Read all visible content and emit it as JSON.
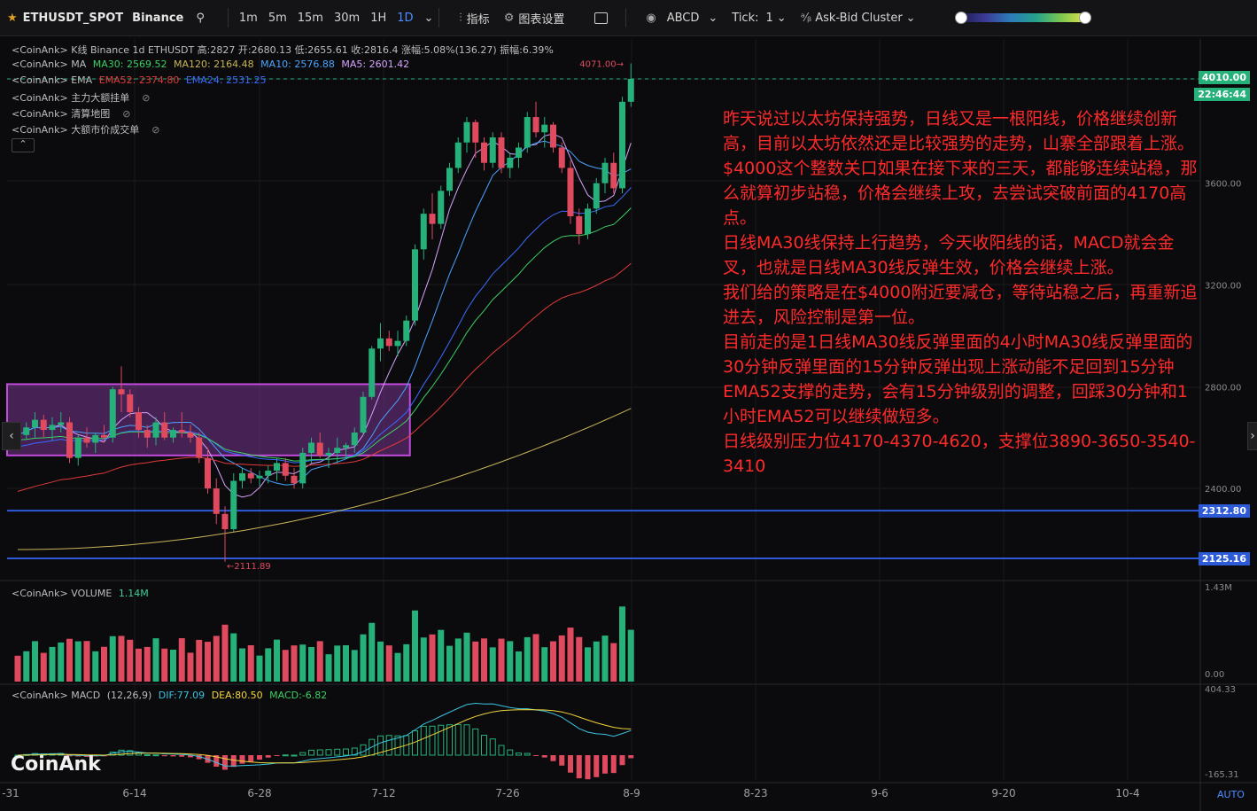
{
  "toolbar": {
    "symbol": "ETHUSDT_SPOT",
    "exchange": "Binance",
    "timeframes": [
      "1m",
      "5m",
      "15m",
      "30m",
      "1H",
      "1D"
    ],
    "active_timeframe": "1D",
    "indicators_label": "指标",
    "chart_settings_label": "图表设置",
    "abcd_label": "ABCD",
    "tick_label": "Tick:",
    "tick_value": "1",
    "cluster_label": "Ask-Bid Cluster"
  },
  "legend": {
    "kline": "<CoinAnk> K线  Binance 1d ETHUSDT 高:2827  开:2680.13  低:2655.61  收:2816.4  涨幅:5.08%(136.27)  振幅:6.39%",
    "ma_prefix": "<CoinAnk> MA",
    "ma30": "MA30: 2569.52",
    "ma120": "MA120: 2164.48",
    "ma10": "MA10: 2576.88",
    "ma5": "MA5: 2601.42",
    "ema_prefix": "<CoinAnk> EMA",
    "ema52": "EMA52: 2374.80",
    "ema24": "EMA24: 2531.25",
    "l4": "<CoinAnk> 主力大额挂单",
    "l5": "<CoinAnk> 清算地图",
    "l6": "<CoinAnk> 大额市价成交单",
    "volume_prefix": "<CoinAnk> VOLUME",
    "volume_value": "1.14M",
    "macd_prefix": "<CoinAnk> MACD",
    "macd_params": "(12,26,9)",
    "dif": "DIF:77.09",
    "dea": "DEA:80.50",
    "macd": "MACD:-6.82"
  },
  "price_axis": {
    "ticks": [
      "3600.00",
      "3200.00",
      "2800.00",
      "2400.00"
    ],
    "current_price": "4010.00",
    "countdown": "22:46:44",
    "line1": "2312.80",
    "line2": "2125.16",
    "high_marker": "4071.00",
    "low_marker": "2111.89"
  },
  "volume_axis": {
    "top": "1.43M",
    "bottom": "0.00"
  },
  "macd_axis": {
    "top": "404.33",
    "bottom": "-165.31"
  },
  "x_axis": [
    "-31",
    "6-14",
    "6-28",
    "7-12",
    "7-26",
    "8-9",
    "8-23",
    "9-6",
    "9-20",
    "10-4"
  ],
  "annotation": [
    "昨天说过以太坊保持强势，日线又是一根阳线，价格继续创新高，目前以太坊依然还是比较强势的走势，山寨全部跟着上涨。",
    "$4000这个整数关口如果在接下来的三天，都能够连续站稳，那么就算初步站稳，价格会继续上攻，去尝试突破前面的4170高点。",
    "日线MA30线保持上行趋势，今天收阳线的话，MACD就会金叉，也就是日线MA30线反弹生效，价格会继续上涨。",
    "我们给的策略是在$4000附近要减仓，等待站稳之后，再重新追进去，风险控制是第一位。",
    "目前走的是1日线MA30线反弹里面的4小时MA30线反弹里面的30分钟反弹里面的15分钟反弹出现上涨动能不足回到15分钟EMA52支撑的走势，会有15分钟级别的调整，回踩30分钟和1小时EMA52可以继续做短多。",
    "日线级别压力位4170-4370-4620，支撑位3890-3650-3540-3410"
  ],
  "logo": "CoinAnk",
  "auto_label": "AUTO",
  "colors": {
    "up": "#26b07a",
    "down": "#e04a5f",
    "accent": "#4c8dff",
    "level_line": "#2d5bd8",
    "annotation": "#ff2a2a"
  },
  "chart_data": {
    "type": "candlestick",
    "interval": "1D",
    "x_range": [
      "5-31",
      "8-9"
    ],
    "y_range": [
      2111.89,
      4071.0
    ],
    "candles": [
      [
        2640,
        2660,
        2580,
        2610
      ],
      [
        2610,
        2660,
        2590,
        2640
      ],
      [
        2640,
        2700,
        2600,
        2670
      ],
      [
        2670,
        2690,
        2600,
        2630
      ],
      [
        2630,
        2680,
        2590,
        2650
      ],
      [
        2650,
        2700,
        2620,
        2660
      ],
      [
        2660,
        2680,
        2500,
        2520
      ],
      [
        2520,
        2610,
        2490,
        2600
      ],
      [
        2600,
        2640,
        2560,
        2580
      ],
      [
        2580,
        2620,
        2540,
        2610
      ],
      [
        2610,
        2650,
        2580,
        2600
      ],
      [
        2600,
        2800,
        2580,
        2790
      ],
      [
        2790,
        2880,
        2700,
        2770
      ],
      [
        2770,
        2790,
        2680,
        2700
      ],
      [
        2700,
        2720,
        2600,
        2630
      ],
      [
        2630,
        2650,
        2560,
        2600
      ],
      [
        2600,
        2680,
        2570,
        2660
      ],
      [
        2660,
        2700,
        2590,
        2600
      ],
      [
        2600,
        2640,
        2580,
        2630
      ],
      [
        2630,
        2700,
        2600,
        2620
      ],
      [
        2620,
        2650,
        2580,
        2600
      ],
      [
        2600,
        2620,
        2500,
        2520
      ],
      [
        2520,
        2560,
        2380,
        2400
      ],
      [
        2400,
        2440,
        2260,
        2300
      ],
      [
        2300,
        2330,
        2111.89,
        2240
      ],
      [
        2240,
        2460,
        2230,
        2430
      ],
      [
        2430,
        2480,
        2400,
        2460
      ],
      [
        2460,
        2480,
        2420,
        2440
      ],
      [
        2440,
        2470,
        2410,
        2450
      ],
      [
        2450,
        2490,
        2420,
        2470
      ],
      [
        2470,
        2520,
        2430,
        2500
      ],
      [
        2500,
        2520,
        2430,
        2450
      ],
      [
        2450,
        2480,
        2400,
        2420
      ],
      [
        2420,
        2560,
        2400,
        2540
      ],
      [
        2540,
        2600,
        2500,
        2580
      ],
      [
        2580,
        2620,
        2520,
        2530
      ],
      [
        2530,
        2560,
        2480,
        2540
      ],
      [
        2540,
        2600,
        2500,
        2560
      ],
      [
        2560,
        2580,
        2520,
        2570
      ],
      [
        2570,
        2640,
        2540,
        2620
      ],
      [
        2620,
        2780,
        2610,
        2760
      ],
      [
        2760,
        2960,
        2750,
        2950
      ],
      [
        2950,
        3050,
        2900,
        2990
      ],
      [
        2990,
        3020,
        2940,
        2960
      ],
      [
        2960,
        3020,
        2920,
        2980
      ],
      [
        2980,
        3080,
        2960,
        3060
      ],
      [
        3060,
        3360,
        3040,
        3340
      ],
      [
        3340,
        3500,
        3300,
        3480
      ],
      [
        3480,
        3560,
        3380,
        3440
      ],
      [
        3440,
        3590,
        3420,
        3570
      ],
      [
        3570,
        3680,
        3550,
        3660
      ],
      [
        3660,
        3780,
        3640,
        3760
      ],
      [
        3760,
        3860,
        3720,
        3840
      ],
      [
        3840,
        3850,
        3700,
        3760
      ],
      [
        3760,
        3780,
        3650,
        3680
      ],
      [
        3680,
        3800,
        3660,
        3780
      ],
      [
        3780,
        3800,
        3640,
        3660
      ],
      [
        3660,
        3720,
        3620,
        3700
      ],
      [
        3700,
        3760,
        3660,
        3740
      ],
      [
        3740,
        3880,
        3720,
        3860
      ],
      [
        3860,
        3920,
        3780,
        3800
      ],
      [
        3800,
        3860,
        3740,
        3830
      ],
      [
        3830,
        3840,
        3720,
        3740
      ],
      [
        3740,
        3760,
        3640,
        3660
      ],
      [
        3660,
        3690,
        3440,
        3470
      ],
      [
        3470,
        3500,
        3360,
        3400
      ],
      [
        3400,
        3520,
        3380,
        3500
      ],
      [
        3500,
        3620,
        3480,
        3600
      ],
      [
        3600,
        3700,
        3560,
        3680
      ],
      [
        3680,
        3720,
        3560,
        3580
      ],
      [
        3580,
        3940,
        3560,
        3920
      ],
      [
        3920,
        4071,
        3900,
        4010
      ]
    ],
    "volume_max": 1.43,
    "macd_range": [
      -165.31,
      404.33
    ],
    "levels": [
      2312.8,
      2125.16
    ],
    "box": {
      "from_index": 0,
      "to_index": 45,
      "high": 2810,
      "low": 2530
    }
  }
}
